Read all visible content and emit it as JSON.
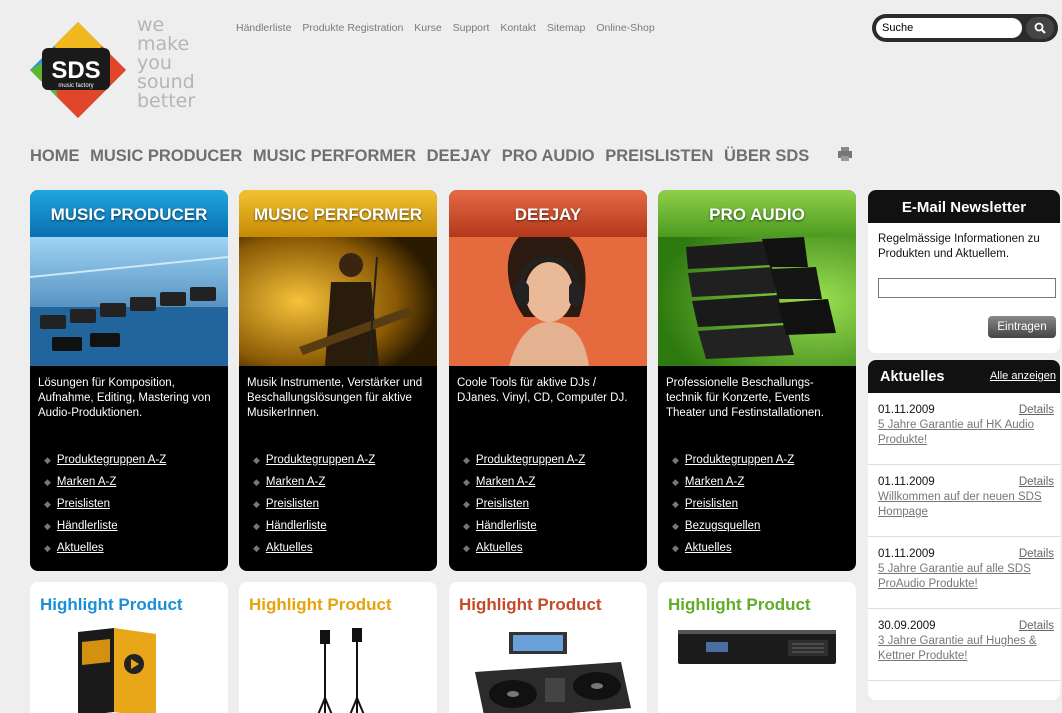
{
  "header": {
    "tagline": [
      "we",
      "make",
      "you",
      "sound",
      "better"
    ],
    "logo_text": "SDS",
    "logo_subtext": "music factory",
    "top_nav": [
      "Händlerliste",
      "Produkte Registration",
      "Kurse",
      "Support",
      "Kontakt",
      "Sitemap",
      "Online-Shop"
    ],
    "search_value": "Suche"
  },
  "main_nav": [
    "HOME",
    "MUSIC PRODUCER",
    "MUSIC PERFORMER",
    "DEEJAY",
    "PRO AUDIO",
    "PREISLISTEN",
    "ÜBER SDS"
  ],
  "cards": [
    {
      "title": "MUSIC PRODUCER",
      "description": "Lösungen für Komposition, Aufnahme, Editing, Mastering von Audio-Produktionen.",
      "links": [
        "Produktegruppen A-Z",
        "Marken A-Z",
        "Preislisten",
        "Händlerliste",
        "Aktuelles"
      ]
    },
    {
      "title": "MUSIC PERFORMER",
      "description": "Musik Instrumente, Verstärker und Beschallungslösungen für aktive MusikerInnen.",
      "links": [
        "Produktegruppen A-Z",
        "Marken A-Z",
        "Preislisten",
        "Händlerliste",
        "Aktuelles"
      ]
    },
    {
      "title": "DEEJAY",
      "description": "Coole Tools für aktive DJs / DJanes. Vinyl, CD, Computer DJ.",
      "links": [
        "Produktegruppen A-Z",
        "Marken A-Z",
        "Preislisten",
        "Händlerliste",
        "Aktuelles"
      ]
    },
    {
      "title": "PRO AUDIO",
      "description": "Professionelle Beschallungs-technik für Konzerte, Events Theater und Festinstallationen.",
      "links": [
        "Produktegruppen A-Z",
        "Marken A-Z",
        "Preislisten",
        "Bezugsquellen",
        "Aktuelles"
      ]
    }
  ],
  "highlights": [
    "Highlight Product",
    "Highlight Product",
    "Highlight Product",
    "Highlight Product"
  ],
  "newsletter": {
    "title": "E-Mail Newsletter",
    "text": "Regelmässige Informationen zu Produkten und Aktuellem.",
    "button": "Eintragen"
  },
  "news": {
    "title": "Aktuelles",
    "show_all": "Alle anzeigen",
    "items": [
      {
        "date": "01.11.2009",
        "details": "Details",
        "text": "5 Jahre Garantie auf HK Audio Produkte!"
      },
      {
        "date": "01.11.2009",
        "details": "Details",
        "text": "Willkommen auf der neuen SDS Hompage"
      },
      {
        "date": "01.11.2009",
        "details": "Details",
        "text": "5 Jahre Garantie auf alle SDS ProAudio Produkte!"
      },
      {
        "date": "30.09.2009",
        "details": "Details",
        "text": "3 Jahre Garantie auf Hughes & Kettner Produkte!"
      }
    ]
  }
}
